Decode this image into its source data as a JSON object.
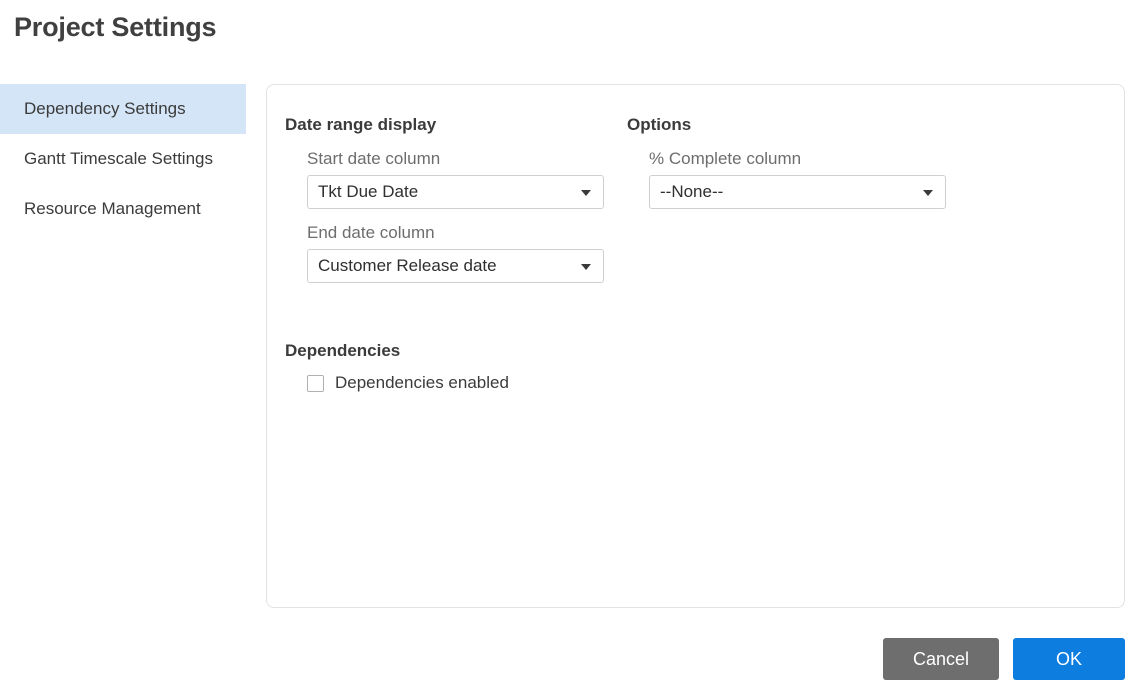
{
  "page": {
    "title": "Project Settings"
  },
  "sidebar": {
    "items": [
      {
        "label": "Dependency Settings",
        "active": true
      },
      {
        "label": "Gantt Timescale Settings",
        "active": false
      },
      {
        "label": "Resource Management",
        "active": false
      }
    ]
  },
  "panel": {
    "date_range": {
      "title": "Date range display",
      "start_date": {
        "label": "Start date column",
        "value": "Tkt Due Date",
        "arrow_icon": "chevron-down-icon"
      },
      "end_date": {
        "label": "End date column",
        "value": "Customer Release date",
        "arrow_icon": "chevron-down-icon"
      }
    },
    "options": {
      "title": "Options",
      "percent_complete": {
        "label": "% Complete column",
        "value": "--None--",
        "arrow_icon": "chevron-down-icon"
      }
    },
    "dependencies": {
      "title": "Dependencies",
      "checkbox": {
        "label": "Dependencies enabled",
        "checked": false
      }
    }
  },
  "footer": {
    "cancel_label": "Cancel",
    "ok_label": "OK"
  },
  "colors": {
    "accent_blue": "#0d7de0",
    "cancel_gray": "#6e6e6e",
    "sidebar_active": "#d3e5f6",
    "panel_border": "#e2e2e2",
    "label_gray": "#6d6d6d",
    "text_dark": "#3b3b3b"
  }
}
